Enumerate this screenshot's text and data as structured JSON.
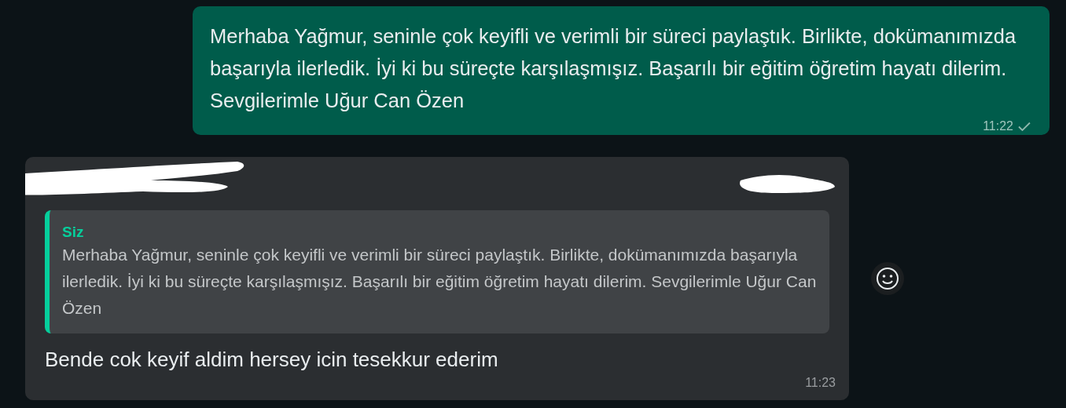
{
  "messages": [
    {
      "kind": "outgoing",
      "text": "Merhaba Yağmur, seninle çok keyifli ve verimli bir süreci paylaştık. Birlikte, dokümanımızda başarıyla ilerledik. İyi ki bu süreçte karşılaşmışız. Başarılı bir eğitim öğretim hayatı dilerim. Sevgilerimle Uğur Can Özen",
      "time": "11:22",
      "delivered": false
    },
    {
      "kind": "incoming",
      "quote": {
        "author": "Siz",
        "text": "Merhaba Yağmur, seninle çok keyifli ve verimli bir süreci paylaştık. Birlikte, dokümanımızda başarıyla ilerledik. İyi ki bu süreçte karşılaşmışız. Başarılı bir eğitim öğretim hayatı dilerim. Sevgilerimle Uğur Can Özen"
      },
      "text": "Bende cok keyif aldim hersey icin tesekkur ederim",
      "time": "11:23"
    }
  ]
}
